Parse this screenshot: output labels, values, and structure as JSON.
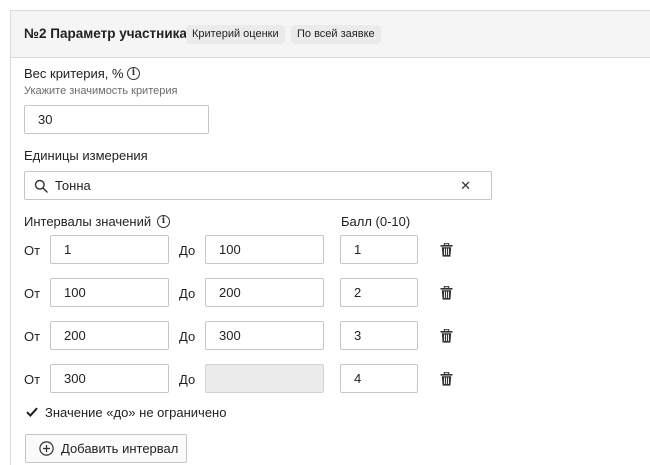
{
  "header": {
    "title": "№2 Параметр участника",
    "badges": [
      "Критерий оценки",
      "По всей заявке"
    ]
  },
  "weight": {
    "label": "Вес критерия, %",
    "hint": "Укажите значимость критерия",
    "value": "30"
  },
  "units": {
    "label": "Единицы измерения",
    "value": "Тонна"
  },
  "intervals": {
    "label": "Интервалы значений",
    "score_label": "Балл (0-10)",
    "from_label": "От",
    "to_label": "До",
    "rows": [
      {
        "from": "1",
        "to": "100",
        "score": "1"
      },
      {
        "from": "100",
        "to": "200",
        "score": "2"
      },
      {
        "from": "200",
        "to": "300",
        "score": "3"
      },
      {
        "from": "300",
        "to": "",
        "score": "4",
        "to_disabled": true
      }
    ]
  },
  "unlimited": {
    "label": "Значение «до» не ограничено",
    "checked": true
  },
  "add_button": {
    "label": "Добавить интервал"
  },
  "icons": {
    "info": "info-icon",
    "search": "search-icon",
    "clear": "close-icon",
    "delete": "trash-icon",
    "check": "check-icon",
    "add": "plus-circle-icon"
  }
}
